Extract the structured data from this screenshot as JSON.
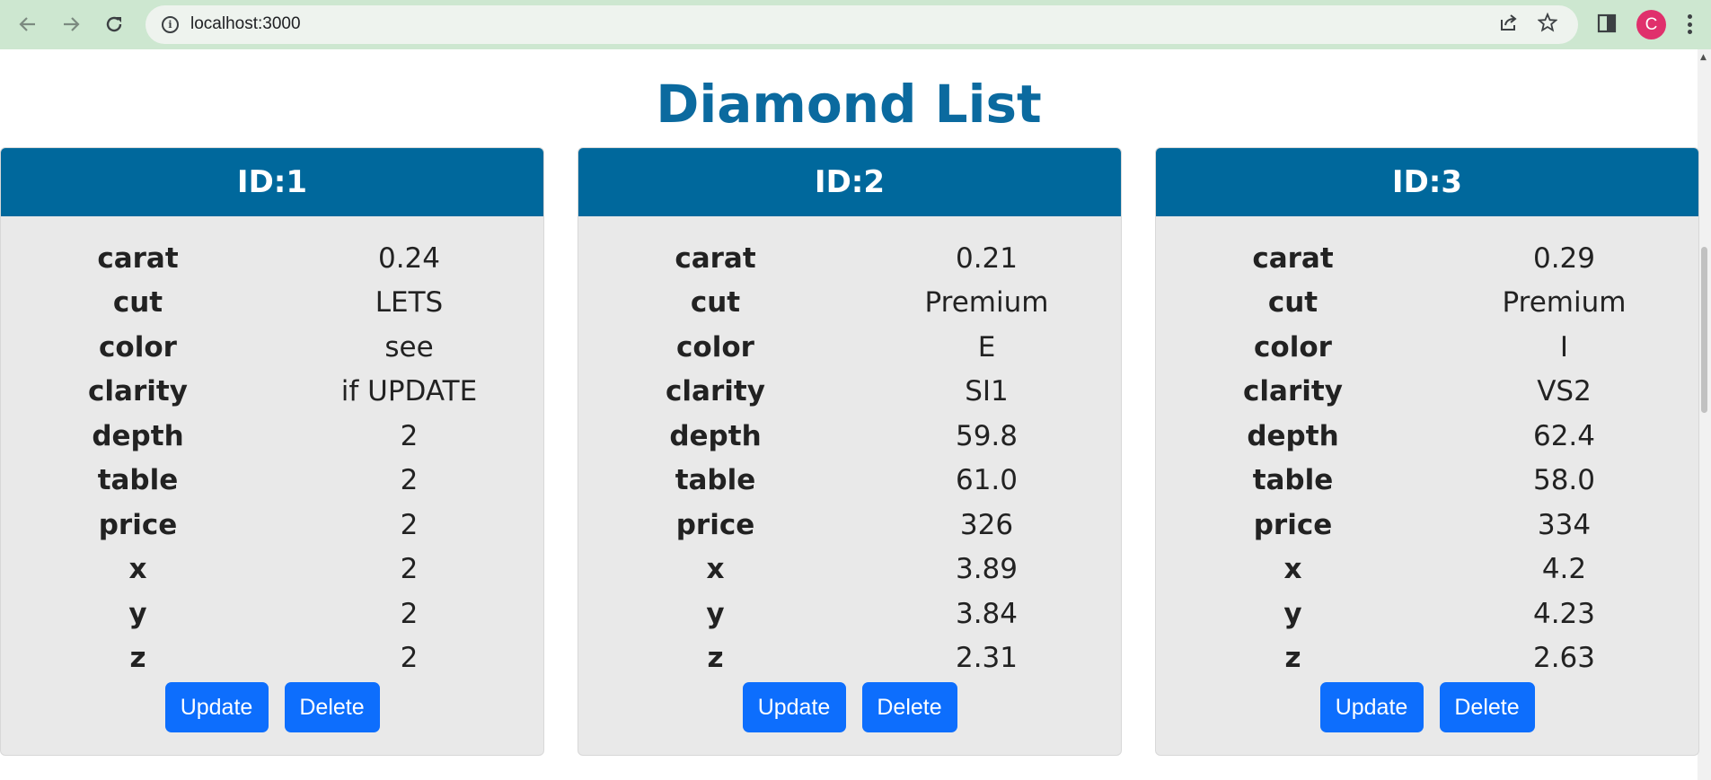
{
  "browser": {
    "url": "localhost:3000",
    "avatar_letter": "C"
  },
  "page": {
    "title": "Diamond List"
  },
  "cards": [
    {
      "header": "ID:1",
      "rows": [
        {
          "key": "carat",
          "value": "0.24"
        },
        {
          "key": "cut",
          "value": "LETS"
        },
        {
          "key": "color",
          "value": "see"
        },
        {
          "key": "clarity",
          "value": "if UPDATE"
        },
        {
          "key": "depth",
          "value": "2"
        },
        {
          "key": "table",
          "value": "2"
        },
        {
          "key": "price",
          "value": "2"
        },
        {
          "key": "x",
          "value": "2"
        },
        {
          "key": "y",
          "value": "2"
        },
        {
          "key": "z",
          "value": "2"
        }
      ],
      "update_label": "Update",
      "delete_label": "Delete"
    },
    {
      "header": "ID:2",
      "rows": [
        {
          "key": "carat",
          "value": "0.21"
        },
        {
          "key": "cut",
          "value": "Premium"
        },
        {
          "key": "color",
          "value": "E"
        },
        {
          "key": "clarity",
          "value": "SI1"
        },
        {
          "key": "depth",
          "value": "59.8"
        },
        {
          "key": "table",
          "value": "61.0"
        },
        {
          "key": "price",
          "value": "326"
        },
        {
          "key": "x",
          "value": "3.89"
        },
        {
          "key": "y",
          "value": "3.84"
        },
        {
          "key": "z",
          "value": "2.31"
        }
      ],
      "update_label": "Update",
      "delete_label": "Delete"
    },
    {
      "header": "ID:3",
      "rows": [
        {
          "key": "carat",
          "value": "0.29"
        },
        {
          "key": "cut",
          "value": "Premium"
        },
        {
          "key": "color",
          "value": "I"
        },
        {
          "key": "clarity",
          "value": "VS2"
        },
        {
          "key": "depth",
          "value": "62.4"
        },
        {
          "key": "table",
          "value": "58.0"
        },
        {
          "key": "price",
          "value": "334"
        },
        {
          "key": "x",
          "value": "4.2"
        },
        {
          "key": "y",
          "value": "4.23"
        },
        {
          "key": "z",
          "value": "2.63"
        }
      ],
      "update_label": "Update",
      "delete_label": "Delete"
    }
  ]
}
